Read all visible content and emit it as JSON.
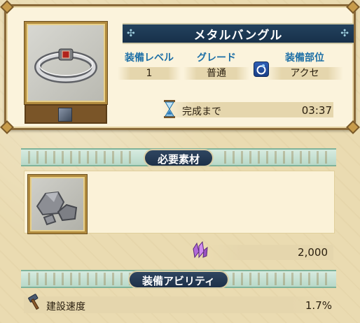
{
  "item": {
    "name": "メタルバングル",
    "level_label": "装備レベル",
    "level_value": "1",
    "grade_label": "グレード",
    "grade_value": "普通",
    "slot_label": "装備部位",
    "slot_value": "アクセ",
    "slot_icon": "accessory-ring-icon",
    "timer_label": "完成まで",
    "timer_value": "03:37"
  },
  "materials": {
    "title": "必要素材",
    "items": [
      {
        "icon": "ore-rocks-icon"
      }
    ],
    "cost_icon": "purple-crystal-icon",
    "cost_value": "2,000"
  },
  "abilities": {
    "title": "装備アビリティ",
    "rows": [
      {
        "icon": "hammer-icon",
        "label": "建設速度",
        "value": "1.7%"
      }
    ]
  },
  "colors": {
    "banner": "#1d3048",
    "stat_label": "#1d6fa6",
    "frame_gold": "#b08a3e",
    "panel_bg": "#fbf3dc"
  }
}
